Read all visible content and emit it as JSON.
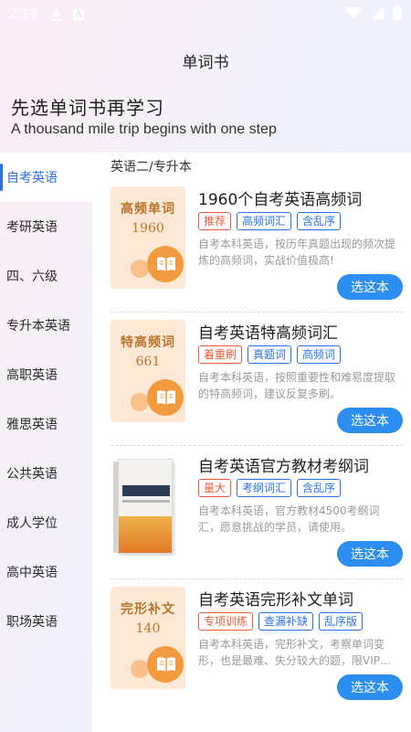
{
  "status": {
    "time": "2:19"
  },
  "nav": {
    "title": "单词书"
  },
  "hero": {
    "title": "先选单词书再学习",
    "subtitle": "A thousand mile trip begins with one step"
  },
  "sidebar": {
    "items": [
      {
        "label": "自考英语",
        "active": true
      },
      {
        "label": "考研英语"
      },
      {
        "label": "四、六级"
      },
      {
        "label": "专升本英语"
      },
      {
        "label": "高职英语"
      },
      {
        "label": "雅思英语"
      },
      {
        "label": "公共英语"
      },
      {
        "label": "成人学位"
      },
      {
        "label": "高中英语"
      },
      {
        "label": "职场英语"
      }
    ]
  },
  "content": {
    "category": "英语二/专升本",
    "books": [
      {
        "title": "1960个自考英语高频词",
        "cover_title": "高频单词",
        "cover_num": "1960",
        "tags": [
          {
            "label": "推荐",
            "color": "red"
          },
          {
            "label": "高频词汇",
            "color": "blue"
          },
          {
            "label": "含乱序",
            "color": "blue"
          }
        ],
        "desc": "自考本科英语，按历年真题出现的频次提炼的高频词，实战价值极高!",
        "button": "选这本"
      },
      {
        "title": "自考英语特高频词汇",
        "cover_title": "特高频词",
        "cover_num": "661",
        "tags": [
          {
            "label": "着重刷",
            "color": "red"
          },
          {
            "label": "真题词",
            "color": "blue"
          },
          {
            "label": "高频词",
            "color": "blue"
          }
        ],
        "desc": "自考本科英语，按照重要性和难易度提取的特高频词，建议反复多刷。",
        "button": "选这本"
      },
      {
        "title": "自考英语官方教材考纲词",
        "cover_title": "",
        "cover_num": "",
        "tags": [
          {
            "label": "量大",
            "color": "red"
          },
          {
            "label": "考纲词汇",
            "color": "blue"
          },
          {
            "label": "含乱序",
            "color": "blue"
          }
        ],
        "desc": "自考本科英语，官方教材4500考纲词汇，愿意挑战的学员，请使用。",
        "button": "选这本"
      },
      {
        "title": "自考英语完形补文单词",
        "cover_title": "完形补文",
        "cover_num": "140",
        "tags": [
          {
            "label": "专项训练",
            "color": "red"
          },
          {
            "label": "查漏补缺",
            "color": "blue"
          },
          {
            "label": "乱序版",
            "color": "blue"
          }
        ],
        "desc": "自考本科英语，完形补文，考察单词变形，也是最难、失分较大的题，限VIP…",
        "button": "选这本"
      }
    ]
  },
  "colors": {
    "accent": "#2a72e8",
    "button": "#2b8ef0",
    "tag_red": "#ef5b3a",
    "cover_bg": "#fde8d6",
    "cover_text": "#b8742a",
    "cover_orange": "#f49a3e"
  }
}
